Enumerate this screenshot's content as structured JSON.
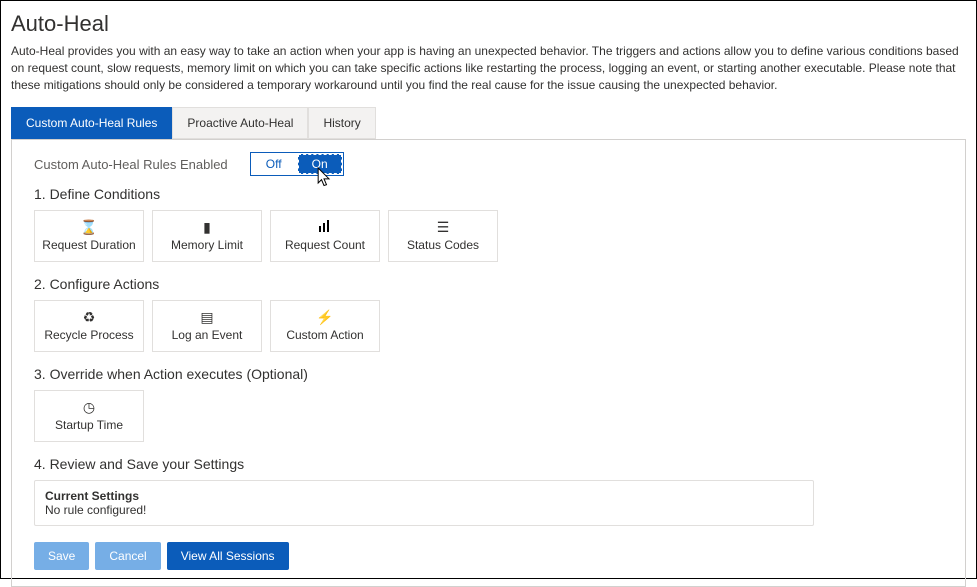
{
  "page": {
    "title": "Auto-Heal",
    "description": "Auto-Heal provides you with an easy way to take an action when your app is having an unexpected behavior. The triggers and actions allow you to define various conditions based on request count, slow requests, memory limit on which you can take specific actions like restarting the process, logging an event, or starting another executable. Please note that these mitigations should only be considered a temporary workaround until you find the real cause for the issue causing the unexpected behavior."
  },
  "tabs": {
    "custom": "Custom Auto-Heal Rules",
    "proactive": "Proactive Auto-Heal",
    "history": "History"
  },
  "enable": {
    "label": "Custom Auto-Heal Rules Enabled",
    "off": "Off",
    "on": "On"
  },
  "sections": {
    "s1": "1. Define Conditions",
    "s2": "2. Configure Actions",
    "s3": "3. Override when Action executes (Optional)",
    "s4": "4. Review and Save your Settings"
  },
  "tiles": {
    "request_duration": "Request Duration",
    "memory_limit": "Memory Limit",
    "request_count": "Request Count",
    "status_codes": "Status Codes",
    "recycle_process": "Recycle Process",
    "log_event": "Log an Event",
    "custom_action": "Custom Action",
    "startup_time": "Startup Time"
  },
  "settings": {
    "title": "Current Settings",
    "value": "No rule configured!"
  },
  "buttons": {
    "save": "Save",
    "cancel": "Cancel",
    "view_all": "View All Sessions"
  }
}
